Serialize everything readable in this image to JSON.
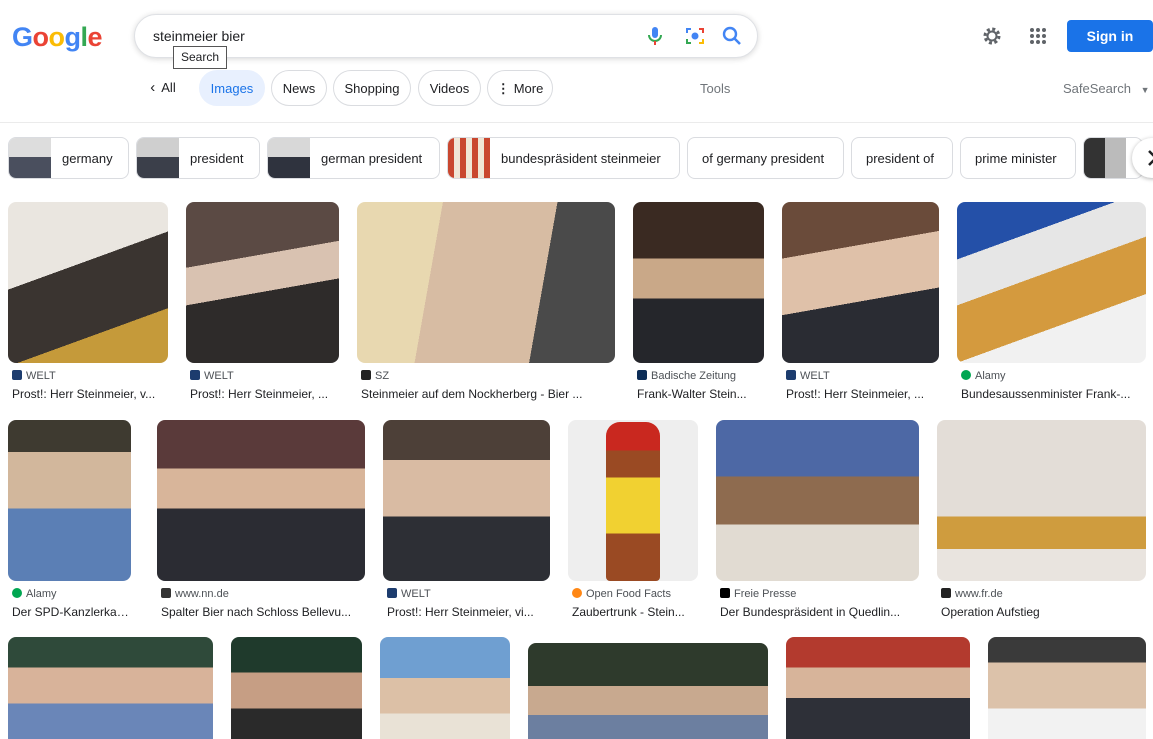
{
  "header": {
    "logo_text": "Google",
    "search_query": "steinmeier bier",
    "tooltip": "Search",
    "sign_in": "Sign in"
  },
  "tabs": {
    "back": "All",
    "items": [
      "Images",
      "News",
      "Shopping",
      "Videos",
      "More"
    ],
    "tools": "Tools",
    "safesearch": "SafeSearch"
  },
  "chips": [
    "germany",
    "president",
    "german president",
    "bundespräsident steinmeier",
    "of germany president",
    "president of",
    "prime minister"
  ],
  "results": [
    {
      "source": "WELT",
      "title": "Prost!: Herr Steinmeier, v..."
    },
    {
      "source": "WELT",
      "title": "Prost!: Herr Steinmeier, ..."
    },
    {
      "source": "SZ",
      "title": "Steinmeier auf dem Nockherberg - Bier ..."
    },
    {
      "source": "Badische Zeitung",
      "title": "Frank-Walter Stein..."
    },
    {
      "source": "WELT",
      "title": "Prost!: Herr Steinmeier, ..."
    },
    {
      "source": "Alamy",
      "title": "Bundesaussenminister Frank-..."
    },
    {
      "source": "Alamy",
      "title": "Der SPD-Kanzlerkan..."
    },
    {
      "source": "www.nn.de",
      "title": "Spalter Bier nach Schloss Bellevu..."
    },
    {
      "source": "WELT",
      "title": "Prost!: Herr Steinmeier, vi..."
    },
    {
      "source": "Open Food Facts",
      "title": "Zaubertrunk - Stein..."
    },
    {
      "source": "Freie Presse",
      "title": "Der Bundespräsident in Quedlin..."
    },
    {
      "source": "www.fr.de",
      "title": "Operation Aufstieg"
    }
  ],
  "colors": {
    "accent": "#1a73e8",
    "chip_active_bg": "#e8f0fe"
  }
}
